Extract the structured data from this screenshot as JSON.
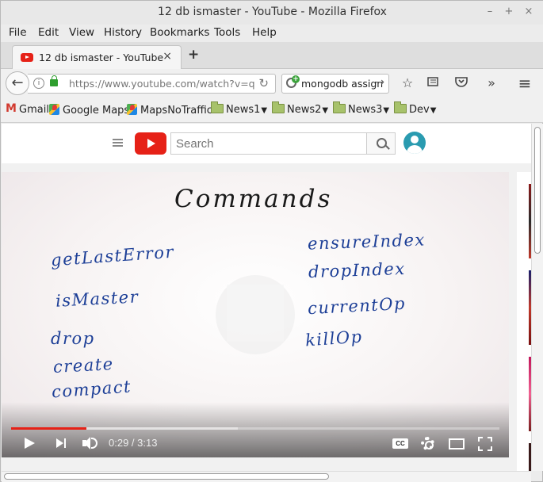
{
  "window": {
    "title": "12 db ismaster - YouTube - Mozilla Firefox",
    "minimize": "–",
    "maximize": "+",
    "close": "×"
  },
  "menu": [
    "File",
    "Edit",
    "View",
    "History",
    "Bookmarks",
    "Tools",
    "Help"
  ],
  "menu_access": [
    "F",
    "E",
    "V",
    "H",
    "B",
    "T",
    "H"
  ],
  "tab": {
    "title": "12 db ismaster - YouTube",
    "close": "×",
    "new_tab": "+"
  },
  "nav": {
    "url": "https://www.youtube.com/watch?v=q",
    "search_value": "mongodb assign",
    "reload": "↻",
    "go": "→",
    "back": "←",
    "overflow": "»",
    "hamburger": "≡",
    "bookmark_star": "☆"
  },
  "bookmarks": [
    {
      "label": "Gmail",
      "icon": "gmail-icon"
    },
    {
      "label": "Google Maps",
      "icon": "maps-icon"
    },
    {
      "label": "MapsNoTraffic",
      "icon": "maps-icon"
    },
    {
      "label": "News1",
      "icon": "folder-icon"
    },
    {
      "label": "News2",
      "icon": "folder-icon"
    },
    {
      "label": "News3",
      "icon": "folder-icon"
    },
    {
      "label": "Dev",
      "icon": "folder-icon"
    }
  ],
  "youtube": {
    "search_placeholder": "Search"
  },
  "video": {
    "title_text": "Commands",
    "left_commands": [
      "getLastError",
      "isMaster",
      "drop",
      "create",
      "compact"
    ],
    "right_commands": [
      "ensureIndex",
      "dropIndex",
      "currentOp",
      "killOp"
    ],
    "time": "0:29 / 3:13",
    "played_fraction": 0.155,
    "buffered_fraction": 0.465,
    "cc_label": "CC"
  },
  "colors": {
    "youtube_red": "#e62117",
    "ink_blue": "#1d3f97",
    "ink_black": "#1a1a1a"
  }
}
